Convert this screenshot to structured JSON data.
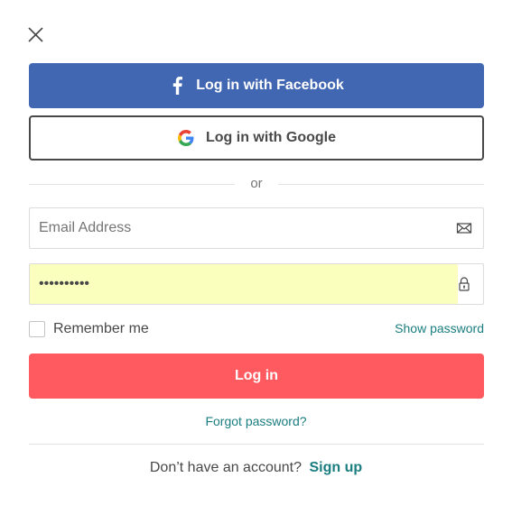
{
  "close": {
    "icon": "close-icon"
  },
  "facebook": {
    "label": "Log in with Facebook",
    "icon": "facebook-icon",
    "color": "#4267b2"
  },
  "google": {
    "label": "Log in with Google",
    "icon": "google-icon"
  },
  "divider": {
    "text": "or"
  },
  "email": {
    "placeholder": "Email Address",
    "value": "",
    "icon": "envelope-icon"
  },
  "password": {
    "value": "••••••••••",
    "icon": "lock-icon",
    "autofill_color": "#faffbd"
  },
  "remember": {
    "label": "Remember me",
    "checked": false
  },
  "show_password": {
    "label": "Show password"
  },
  "login": {
    "label": "Log in",
    "color": "#ff5a5f"
  },
  "forgot": {
    "label": "Forgot password?"
  },
  "signup": {
    "prompt": "Don’t have an account?",
    "link": "Sign up"
  },
  "colors": {
    "link": "#1a7d7f",
    "text": "#484848"
  }
}
